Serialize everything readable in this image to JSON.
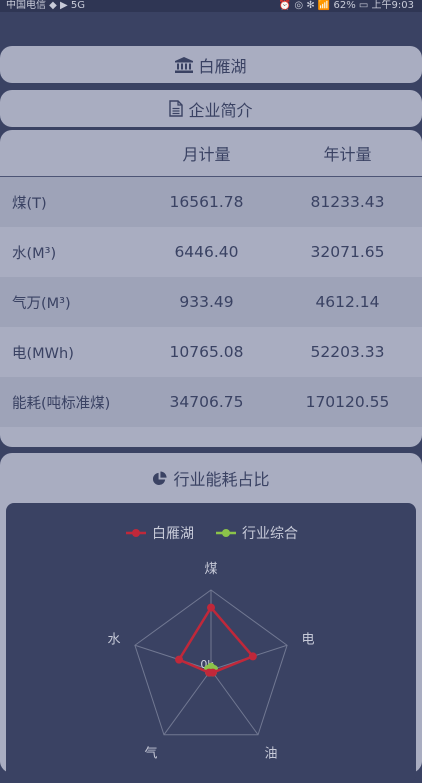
{
  "status_bar": {
    "left": "中国电信 ◆ ▶ 5G",
    "right": "⏰ ◎ ✻ 📶 62% ▭ 上午9:03"
  },
  "header": {
    "title": "白雁湖",
    "subtitle": "企业简介"
  },
  "table": {
    "columns": [
      "",
      "月计量",
      "年计量"
    ],
    "rows": [
      {
        "label": "煤(T)",
        "month": "16561.78",
        "year": "81233.43"
      },
      {
        "label": "水(M³)",
        "month": "6446.40",
        "year": "32071.65"
      },
      {
        "label": "气万(M³)",
        "month": "933.49",
        "year": "4612.14"
      },
      {
        "label": "电(MWh)",
        "month": "10765.08",
        "year": "52203.33"
      },
      {
        "label": "能耗(吨标准煤)",
        "month": "34706.75",
        "year": "170120.55"
      }
    ]
  },
  "chart_section": {
    "title": "行业能耗占比"
  },
  "chart_data": {
    "type": "radar",
    "legend_position": "top",
    "indicators": [
      "煤",
      "电",
      "油",
      "气",
      "水"
    ],
    "center_label": "0k",
    "series": [
      {
        "name": "白雁湖",
        "color": "#c0283a",
        "values": [
          0.78,
          0.55,
          0.0,
          0.02,
          0.42
        ]
      },
      {
        "name": "行业综合",
        "color": "#8bc34a",
        "values": [
          0.03,
          0.03,
          0.03,
          0.03,
          0.03
        ]
      }
    ]
  }
}
